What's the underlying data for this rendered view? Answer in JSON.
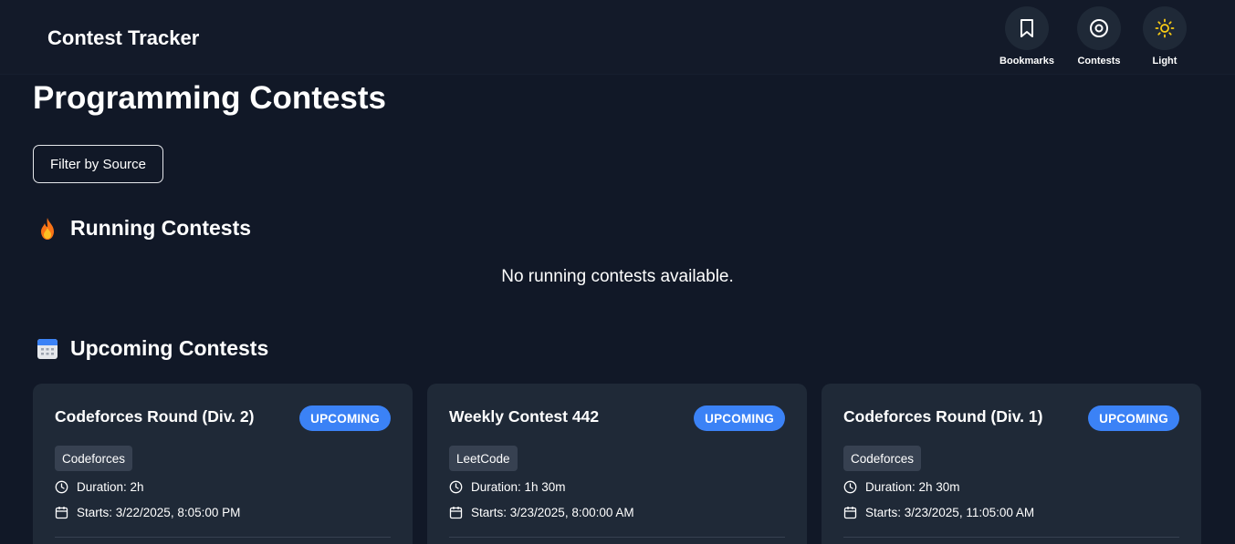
{
  "app": {
    "brand": "Contest Tracker"
  },
  "nav": {
    "bookmarks_label": "Bookmarks",
    "contests_label": "Contests",
    "theme_label": "Light"
  },
  "page": {
    "title": "Programming Contests",
    "filter_label": "Filter by Source"
  },
  "running": {
    "title": "Running Contests",
    "empty_message": "No running contests available."
  },
  "upcoming": {
    "title": "Upcoming Contests",
    "contests": [
      {
        "title": "Codeforces Round (Div. 2)",
        "status": "UPCOMING",
        "source": "Codeforces",
        "duration": "Duration: 2h",
        "starts": "Starts: 3/22/2025, 8:05:00 PM"
      },
      {
        "title": "Weekly Contest 442",
        "status": "UPCOMING",
        "source": "LeetCode",
        "duration": "Duration: 1h 30m",
        "starts": "Starts: 3/23/2025, 8:00:00 AM"
      },
      {
        "title": "Codeforces Round (Div. 1)",
        "status": "UPCOMING",
        "source": "Codeforces",
        "duration": "Duration: 2h 30m",
        "starts": "Starts: 3/23/2025, 11:05:00 AM"
      }
    ]
  },
  "colors": {
    "background": "#111827",
    "navbar": "#131a29",
    "card": "#1f2937",
    "badge": "#3b82f6",
    "tag": "#374151",
    "sun_icon": "#facc15"
  },
  "icons": {
    "bookmarks": "bookmark-icon",
    "contests": "target-icon",
    "theme": "sun-icon",
    "running": "fire-icon",
    "upcoming": "calendar-icon",
    "duration": "clock-icon",
    "starts": "calendar-icon"
  }
}
